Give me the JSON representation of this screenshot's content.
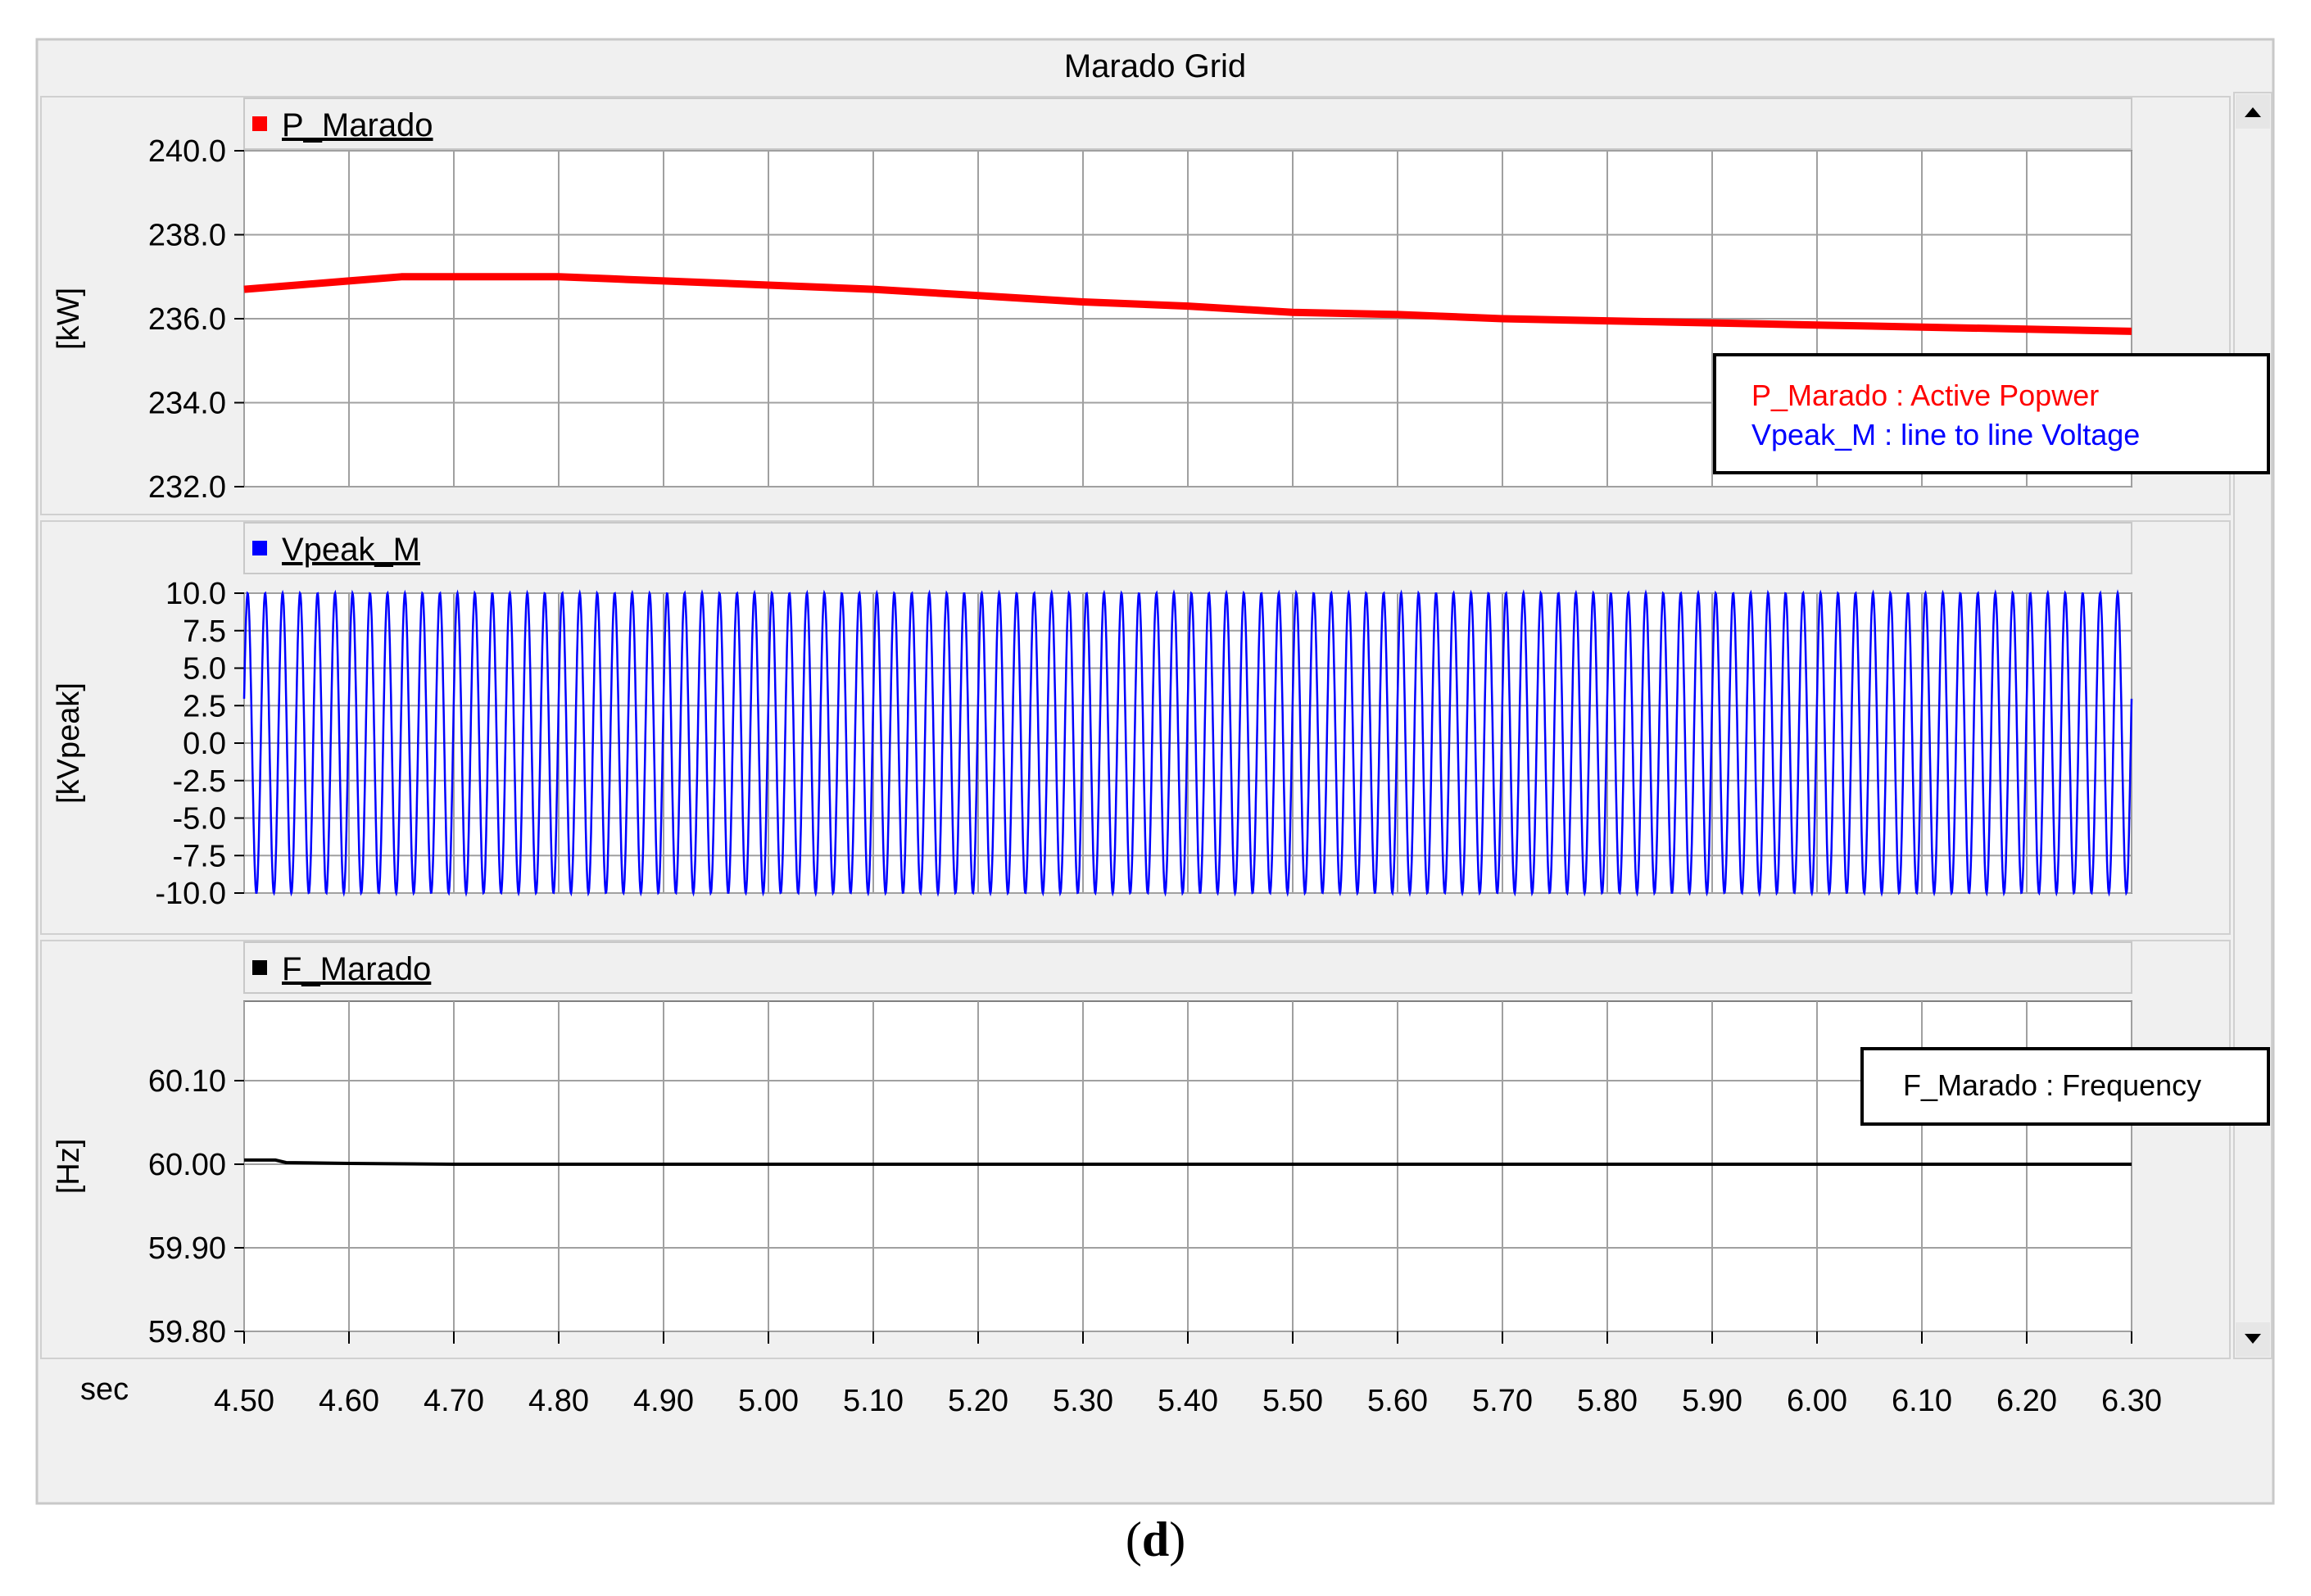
{
  "window": {
    "title": "Marado Grid"
  },
  "caption": {
    "open": "(",
    "letter": "d",
    "close": ")"
  },
  "x_axis": {
    "unit_label": "sec",
    "ticks": [
      "4.50",
      "4.60",
      "4.70",
      "4.80",
      "4.90",
      "5.00",
      "5.10",
      "5.20",
      "5.30",
      "5.40",
      "5.50",
      "5.60",
      "5.70",
      "5.80",
      "5.90",
      "6.00",
      "6.10",
      "6.20",
      "6.30"
    ]
  },
  "colors": {
    "p": "#ff0000",
    "v": "#0000ff",
    "f": "#000000",
    "grid": "#a0a0a0",
    "panel": "#f0f0f0"
  },
  "legend_boxes": {
    "top": {
      "line1": "P_Marado : Active Popwer",
      "line2": "Vpeak_M : line to line Voltage"
    },
    "bottom": {
      "line1": "F_Marado : Frequency"
    }
  },
  "chart_data": [
    {
      "type": "line",
      "series": [
        {
          "name": "P_Marado",
          "x": [
            4.5,
            4.55,
            4.6,
            4.65,
            4.7,
            4.75,
            4.8,
            4.85,
            4.9,
            4.95,
            5.0,
            5.1,
            5.2,
            5.3,
            5.4,
            5.5,
            5.6,
            5.7,
            5.8,
            5.9,
            6.0,
            6.1,
            6.2,
            6.3
          ],
          "y": [
            236.7,
            236.8,
            236.9,
            237.0,
            237.0,
            237.0,
            237.0,
            236.95,
            236.9,
            236.85,
            236.8,
            236.7,
            236.55,
            236.4,
            236.3,
            236.15,
            236.1,
            236.0,
            235.95,
            235.9,
            235.85,
            235.8,
            235.75,
            235.7
          ]
        }
      ],
      "ylabel": "[kW]",
      "ylim": [
        232.0,
        240.0
      ],
      "yticks": [
        "240.0",
        "238.0",
        "236.0",
        "234.0",
        "232.0"
      ],
      "xlim": [
        4.5,
        6.3
      ],
      "legend_placement": "top-left",
      "grid": true
    },
    {
      "type": "line",
      "series": [
        {
          "name": "Vpeak_M",
          "waveform": "sine",
          "amplitude": 10.0,
          "frequency_hz": 60
        }
      ],
      "ylabel": "[kVpeak]",
      "ylim": [
        -10.0,
        10.0
      ],
      "yticks": [
        "10.0",
        "7.5",
        "5.0",
        "2.5",
        "0.0",
        "-2.5",
        "-5.0",
        "-7.5",
        "-10.0"
      ],
      "xlim": [
        4.5,
        6.3
      ],
      "legend_placement": "top-left",
      "grid": true
    },
    {
      "type": "line",
      "series": [
        {
          "name": "F_Marado",
          "x": [
            4.5,
            4.53,
            4.54,
            4.6,
            4.7,
            4.8,
            4.9,
            5.0,
            5.5,
            6.0,
            6.3
          ],
          "y": [
            60.005,
            60.005,
            60.002,
            60.001,
            60.0,
            60.0,
            60.0,
            60.0,
            60.0,
            60.0,
            60.0
          ]
        }
      ],
      "ylabel": "[Hz]",
      "ylim": [
        59.8,
        60.2
      ],
      "yticks": [
        "60.10",
        "60.00",
        "59.90",
        "59.80"
      ],
      "xlim": [
        4.5,
        6.3
      ],
      "legend_placement": "top-left",
      "grid": true
    }
  ]
}
